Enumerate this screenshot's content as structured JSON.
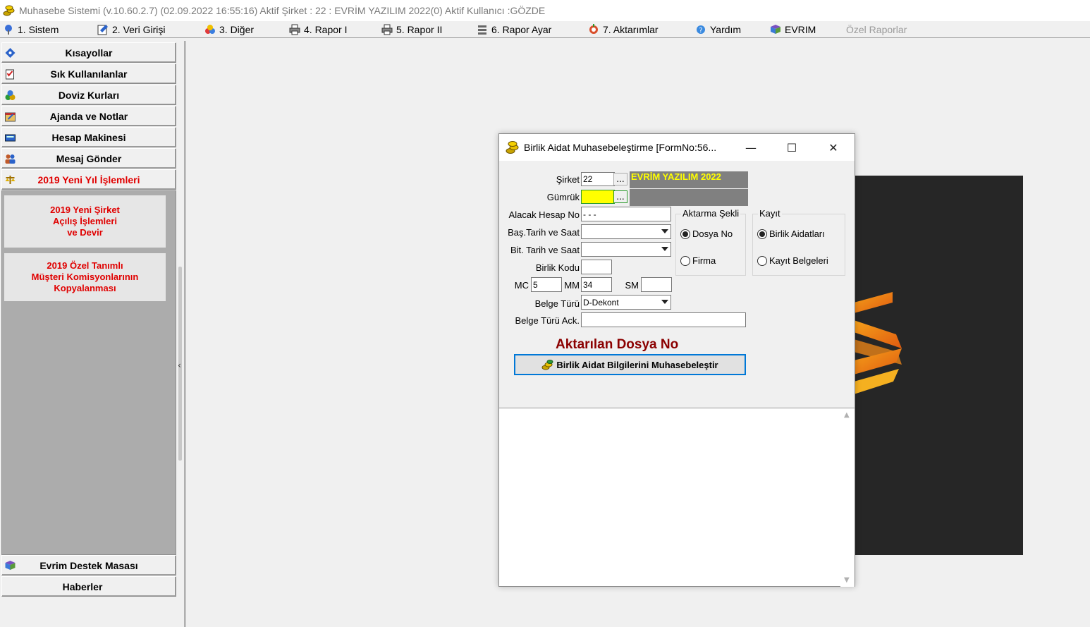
{
  "window": {
    "title": "Muhasebe Sistemi (v.10.60.2.7) (02.09.2022 16:55:16) Aktif Şirket : 22 : EVRİM YAZILIM  2022(0) Aktif Kullanıcı :GÖZDE"
  },
  "menu": {
    "items": [
      {
        "label": "1.   Sistem",
        "icon": "system-icon"
      },
      {
        "label": "2.   Veri Girişi",
        "icon": "data-entry-icon"
      },
      {
        "label": "3.   Diğer",
        "icon": "other-icon"
      },
      {
        "label": "4.   Rapor I",
        "icon": "printer-icon"
      },
      {
        "label": "5.   Rapor II",
        "icon": "printer-icon"
      },
      {
        "label": "6.   Rapor Ayar",
        "icon": "report-settings-icon"
      },
      {
        "label": "7.   Aktarımlar",
        "icon": "transfer-icon"
      },
      {
        "label": "Yardım",
        "icon": "help-icon"
      },
      {
        "label": "EVRIM",
        "icon": "book-icon"
      },
      {
        "label": "Özel Raporlar",
        "icon": "",
        "disabled": true
      }
    ]
  },
  "sidebar": {
    "items": [
      {
        "label": "Kısayollar",
        "icon": "diamond-icon"
      },
      {
        "label": "Sık Kullanılanlar",
        "icon": "checklist-icon"
      },
      {
        "label": "Doviz Kurları",
        "icon": "coins-icon"
      },
      {
        "label": "Ajanda ve Notlar",
        "icon": "agenda-icon"
      },
      {
        "label": "Hesap Makinesi",
        "icon": "calculator-icon"
      },
      {
        "label": "Mesaj Gönder",
        "icon": "users-icon"
      },
      {
        "label": "2019 Yeni Yıl İşlemleri",
        "icon": "scales-icon"
      }
    ],
    "cards": [
      {
        "label": "2019 Yeni Şirket\nAçılış İşlemleri\nve Devir"
      },
      {
        "label": "2019 Özel Tanımlı\nMüşteri Komisyonlarının\nKopyalanması"
      }
    ],
    "bottom_items": [
      {
        "label": "Evrim Destek Masası",
        "icon": "book-icon"
      },
      {
        "label": "Haberler",
        "icon": ""
      }
    ]
  },
  "dialog": {
    "title": "Birlik Aidat Muhasebeleştirme [FormNo:56...",
    "controls": {
      "minimize": "—",
      "maximize": "☐",
      "close": "✕"
    },
    "fields": {
      "sirket": {
        "label": "Şirket",
        "value": "22",
        "company_name": "EVRİM YAZILIM  2022"
      },
      "gumruk": {
        "label": "Gümrük",
        "value": ""
      },
      "alacak_hesap_no": {
        "label": "Alacak Hesap No",
        "value": " -  -  - "
      },
      "bas_tarih": {
        "label": "Baş.Tarih ve Saat",
        "value": ""
      },
      "bit_tarih": {
        "label": "Bit. Tarih ve Saat",
        "value": ""
      },
      "birlik_kodu": {
        "label": "Birlik Kodu",
        "value": ""
      },
      "mc": {
        "label": "MC",
        "value": "5"
      },
      "mm": {
        "label": "MM",
        "value": "34"
      },
      "sm": {
        "label": "SM",
        "value": ""
      },
      "belge_turu": {
        "label": "Belge Türü",
        "value": "D-Dekont"
      },
      "belge_turu_ack": {
        "label": "Belge Türü Ack.",
        "value": ""
      }
    },
    "aktarma_sekli": {
      "caption": "Aktarma Şekli",
      "options": [
        {
          "label": "Dosya No",
          "selected": true
        },
        {
          "label": "Firma",
          "selected": false
        }
      ]
    },
    "kayit": {
      "caption": "Kayıt",
      "options": [
        {
          "label": "Birlik Aidatları",
          "selected": true
        },
        {
          "label": "Kayıt Belgeleri",
          "selected": false
        }
      ]
    },
    "status_label": "Aktarılan Dosya No",
    "action_button": "Birlik Aidat Bilgilerini Muhasebeleştir",
    "ellipsis": "..."
  },
  "colors": {
    "sidebar_red": "#e00000",
    "status_red": "#8b0000",
    "highlight_yellow": "#ffff00",
    "button_border": "#0078d7"
  }
}
